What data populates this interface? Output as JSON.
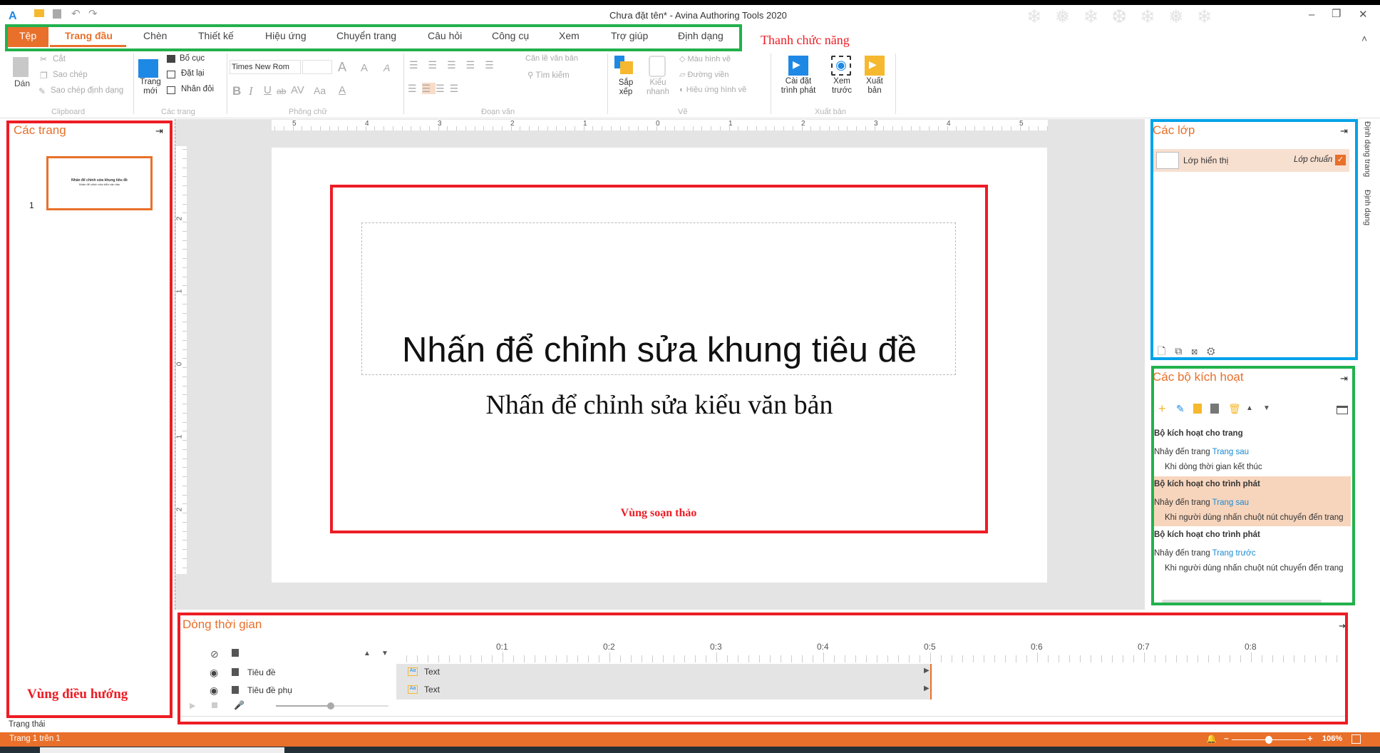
{
  "titlebar": {
    "title": "Chưa đặt tên* - Avina Authoring Tools 2020",
    "minimize": "–",
    "maximize": "❐",
    "close": "✕",
    "collapse_ribbon": "˄"
  },
  "annotations": {
    "ribbon": "Thanh chức năng",
    "editor": "Vùng soạn thảo",
    "navigation": "Vùng điều hướng"
  },
  "tabs": [
    {
      "label": "Tệp"
    },
    {
      "label": "Trang đầu"
    },
    {
      "label": "Chèn"
    },
    {
      "label": "Thiết kế"
    },
    {
      "label": "Hiệu ứng"
    },
    {
      "label": "Chuyển trang"
    },
    {
      "label": "Câu hỏi"
    },
    {
      "label": "Công cụ"
    },
    {
      "label": "Xem"
    },
    {
      "label": "Trợ giúp"
    },
    {
      "label": "Định dạng"
    }
  ],
  "ribbon": {
    "clipboard": {
      "label": "Clipboard",
      "paste": "Dán",
      "cut": "Cắt",
      "copy": "Sao chép",
      "format_painter": "Sao chép định dạng"
    },
    "pages": {
      "label": "Các trang",
      "new_page": "Trang mới",
      "layout": "Bố cục",
      "reset": "Đặt lại",
      "duplicate": "Nhân đôi"
    },
    "font": {
      "label": "Phông chữ",
      "font_name": "Times New Rom",
      "font_size": "",
      "bold": "B",
      "italic": "I",
      "underline": "U",
      "strike": "ab",
      "spacing": "AV",
      "case": "Aa",
      "color": "A"
    },
    "paragraph": {
      "label": "Đoạn văn",
      "align_text": "Căn lề văn bản",
      "find": "Tìm kiếm"
    },
    "draw": {
      "label": "Vẽ",
      "arrange": "Sắp xếp",
      "quick_styles": "Kiểu nhanh",
      "shape_fill": "Màu hình vẽ",
      "outline": "Đường viền",
      "shape_effects": "Hiệu ứng hình vẽ"
    },
    "publish": {
      "label": "Xuất bản",
      "player_settings": "Cài đặt trình phát",
      "preview": "Xem trước",
      "publish": "Xuất bản"
    }
  },
  "pages_panel": {
    "title": "Các trang",
    "pages": [
      {
        "number": "1",
        "title": "Nhấn để chỉnh sửa khung tiêu đề",
        "subtitle": "Nhấn để chỉnh sửa kiểu văn bản"
      }
    ]
  },
  "ruler": {
    "h": [
      "5",
      "4",
      "3",
      "2",
      "1",
      "0",
      "1",
      "2",
      "3",
      "4",
      "5"
    ],
    "v": [
      "2",
      "1",
      "0",
      "1",
      "2"
    ]
  },
  "slide": {
    "title": "Nhấn để chỉnh sửa khung tiêu đề",
    "subtitle": "Nhấn để chỉnh sửa kiểu văn bản"
  },
  "layers_panel": {
    "title": "Các lớp",
    "layers": [
      {
        "name": "Lớp hiển thị",
        "type": "Lớp chuẩn",
        "checked": true
      }
    ]
  },
  "side_tabs": {
    "page_format": "Định dạng trang",
    "format": "Định dạng"
  },
  "triggers_panel": {
    "title": "Các bộ kích hoạt",
    "groups": [
      {
        "heading": "Bộ kích hoạt cho trang",
        "action": "Nhảy đến trang",
        "target": "Trang sau",
        "condition": "Khi dòng thời gian kết thúc",
        "selected": false
      },
      {
        "heading": "Bộ kích hoạt cho trình phát",
        "action": "Nhảy đến trang",
        "target": "Trang sau",
        "condition": "Khi người dùng nhấn chuột nút chuyển đến trang",
        "selected": true
      },
      {
        "heading": "Bộ kích hoạt cho trình phát",
        "action": "Nhảy đến trang",
        "target": "Trang trước",
        "condition": "Khi người dùng nhấn chuột nút chuyển đến trang",
        "selected": false
      }
    ]
  },
  "timeline": {
    "title": "Dòng thời gian",
    "ticks": [
      "0:1",
      "0:2",
      "0:3",
      "0:4",
      "0:5",
      "0:6",
      "0:7",
      "0:8"
    ],
    "rows": [
      {
        "name": "Tiêu đề",
        "item": "Text"
      },
      {
        "name": "Tiêu đề phụ",
        "item": "Text"
      }
    ]
  },
  "status": {
    "label": "Trạng thái",
    "page": "Trang 1 trên 1",
    "zoom": "106%",
    "zoom_minus": "–",
    "zoom_plus": "+",
    "zoom_level": 0.5
  },
  "colors": {
    "accent": "#e8702a",
    "annotation_red": "#ed1c24",
    "annotation_green": "#22b14c",
    "annotation_blue": "#00a2e8",
    "link": "#1a8ad4"
  }
}
